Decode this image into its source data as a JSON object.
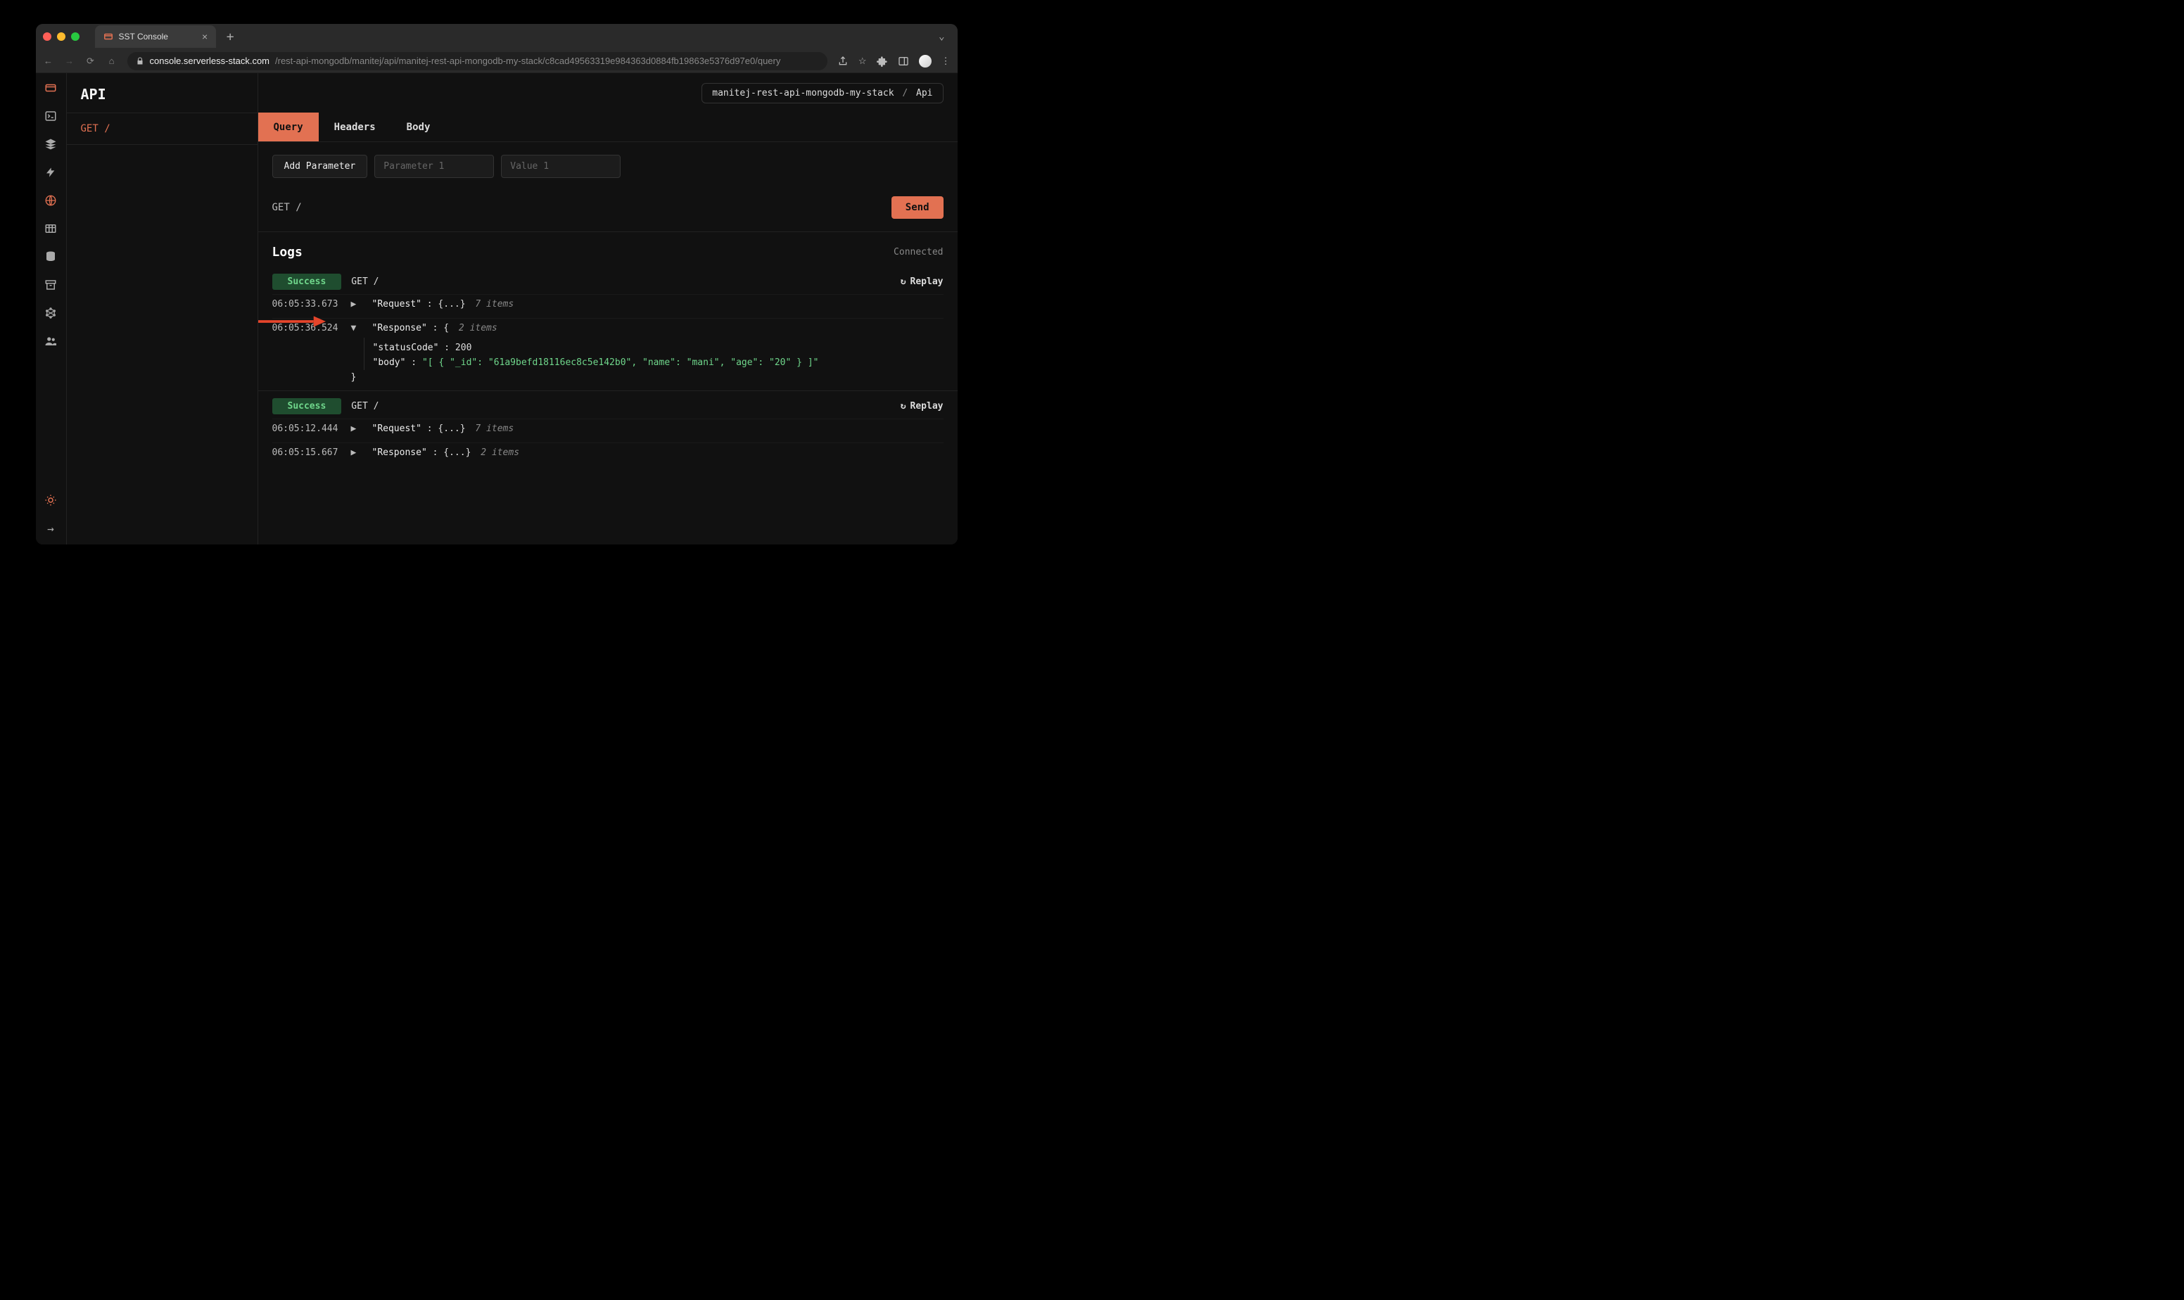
{
  "browser": {
    "tab_title": "SST Console",
    "url_host": "console.serverless-stack.com",
    "url_path": "/rest-api-mongodb/manitej/api/manitej-rest-api-mongodb-my-stack/c8cad49563319e984363d0884fb19863e5376d97e0/query"
  },
  "breadcrumb": {
    "stack": "manitej-rest-api-mongodb-my-stack",
    "resource": "Api"
  },
  "panel_title": "API",
  "endpoints": [
    {
      "method": "GET",
      "path": "/"
    }
  ],
  "tabs": {
    "query": "Query",
    "headers": "Headers",
    "body": "Body"
  },
  "params": {
    "add_label": "Add Parameter",
    "key_placeholder": "Parameter 1",
    "value_placeholder": "Value 1"
  },
  "request_display": "GET /",
  "send_label": "Send",
  "logs": {
    "title": "Logs",
    "status": "Connected",
    "replay_label": "Replay",
    "success_label": "Success",
    "entries": [
      {
        "path": "GET /",
        "request": {
          "ts": "06:05:33.673",
          "label": "Request",
          "count": "7 items"
        },
        "response": {
          "ts": "06:05:36.524",
          "label": "Response",
          "count": "2 items",
          "expanded": true,
          "statusCode_key": "statusCode",
          "statusCode_val": "200",
          "body_key": "body",
          "body_val": "\"[ { \"_id\": \"61a9befd18116ec8c5e142b0\", \"name\": \"mani\", \"age\": \"20\" } ]\""
        }
      },
      {
        "path": "GET /",
        "request": {
          "ts": "06:05:12.444",
          "label": "Request",
          "count": "7 items"
        },
        "response": {
          "ts": "06:05:15.667",
          "label": "Response",
          "count": "2 items",
          "expanded": false
        }
      }
    ]
  }
}
